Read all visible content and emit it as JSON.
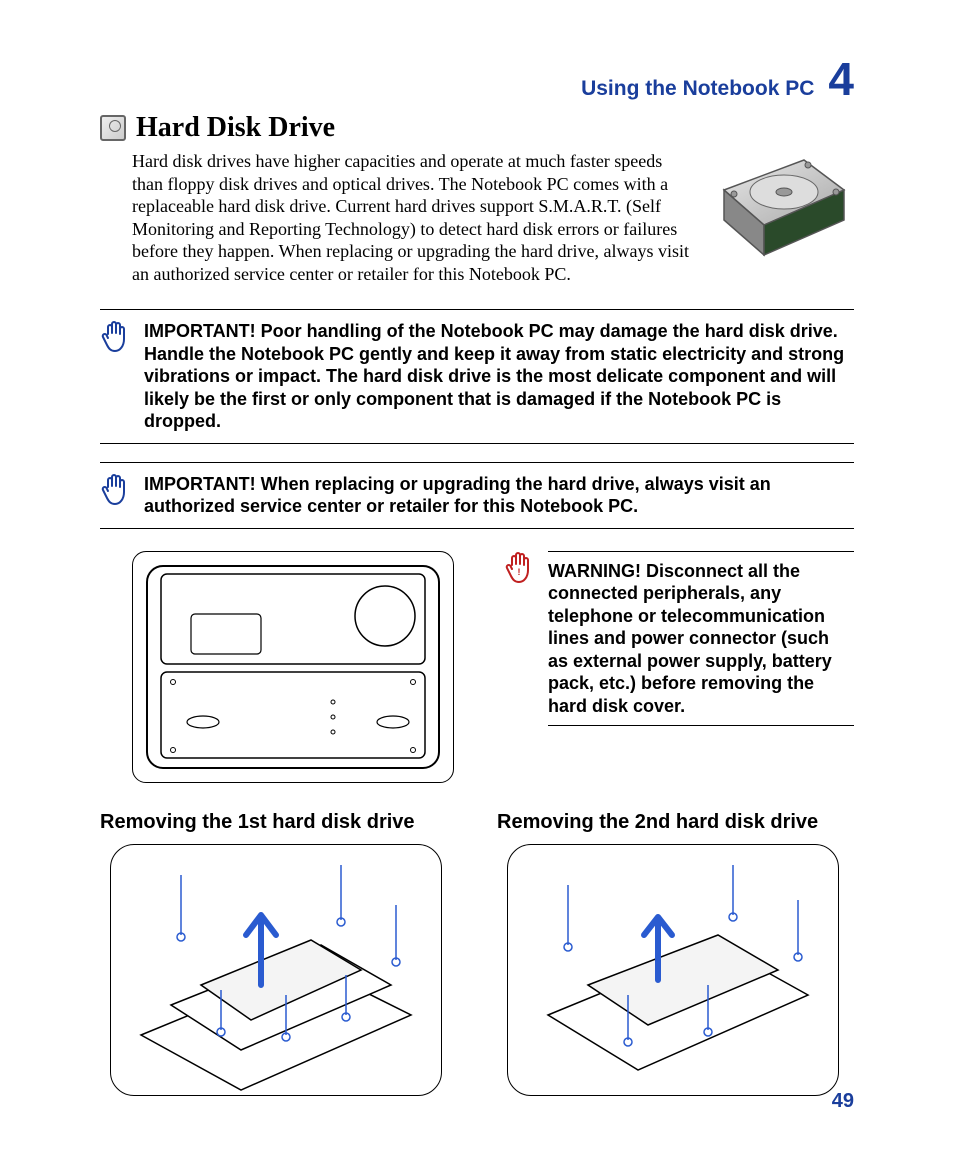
{
  "header": {
    "title": "Using the Notebook PC",
    "chapter_number": "4"
  },
  "section": {
    "title": "Hard Disk Drive",
    "intro": "Hard disk drives have higher capacities and operate at much faster speeds than floppy disk drives and optical drives. The Notebook PC comes with a replaceable hard disk drive. Current hard drives support S.M.A.R.T. (Self Monitoring and Reporting Technology) to detect hard disk errors or failures before they happen. When replacing or upgrading the hard drive, always visit an authorized service center or retailer for this Notebook PC."
  },
  "notices": {
    "important1": "IMPORTANT!  Poor handling of the Notebook PC may damage the hard disk drive. Handle the Notebook PC gently and keep it away from static electricity and strong vibrations or impact. The hard disk drive is the most delicate component and will likely be the first or only component that is damaged if the Notebook PC is dropped.",
    "important2": "IMPORTANT!  When replacing or upgrading the hard drive, always visit an authorized service center or retailer for this Notebook PC.",
    "warning": "WARNING! Disconnect all the connected peripherals, any telephone or telecommunication lines and power connector (such as external power supply, battery pack, etc.) before removing the hard disk cover."
  },
  "subsections": {
    "remove1": "Removing the 1st hard disk drive",
    "remove2": "Removing the 2nd hard disk drive"
  },
  "page_number": "49",
  "icons": {
    "hdd_title": "hard-disk-icon",
    "hand_blue": "hand-stop-icon",
    "hand_red": "hand-warning-icon",
    "hdd_photo": "hard-disk-photo",
    "laptop_bottom": "laptop-underside-diagram",
    "removal1": "hdd-removal-diagram-1",
    "removal2": "hdd-removal-diagram-2"
  }
}
